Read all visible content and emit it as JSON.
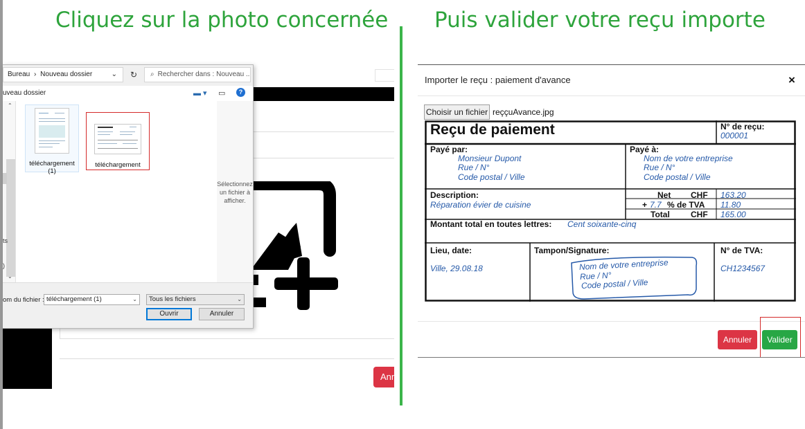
{
  "left": {
    "heading": "Cliquez sur la photo concernée",
    "dialog": {
      "breadcrumb": [
        "Bureau",
        "Nouveau dossier"
      ],
      "search_placeholder": "Rechercher dans : Nouveau ...",
      "new_folder_label": "uveau dossier",
      "files": [
        {
          "name_line1": "téléchargement",
          "name_line2": "(1)"
        },
        {
          "name_line1": "téléchargement",
          "name_line2": ""
        }
      ],
      "preview_text": [
        "Sélectionnez",
        "un fichier à",
        "afficher."
      ],
      "filename_label": "om du fichier :",
      "filename_value": "téléchargement (1)",
      "filetype_value": "Tous les fichiers",
      "open_label": "Ouvrir",
      "cancel_label": "Annuler",
      "nav_fragments": [
        "ts",
        ")"
      ]
    },
    "background_cancel_label": "Ann"
  },
  "right": {
    "heading": "Puis valider votre reçu importe",
    "modal": {
      "title": "Importer le reçu : paiement d'avance",
      "close_glyph": "×",
      "choose_file_label": "Choisir un fichier",
      "chosen_file": "reççuAvance.jpg",
      "cancel_label": "Annuler",
      "validate_label": "Valider"
    },
    "receipt": {
      "title": "Reçu de paiement",
      "number_label": "N° de reçu:",
      "number_value": "000001",
      "paid_by_label": "Payé par:",
      "paid_by_lines": [
        "Monsieur Dupont",
        "Rue / N°",
        "Code postal / Ville"
      ],
      "paid_to_label": "Payé à:",
      "paid_to_lines": [
        "Nom de votre entreprise",
        "Rue / N°",
        "Code postal / Ville"
      ],
      "description_label": "Description:",
      "description_value": "Réparation évier de cuisine",
      "net_label": "Net",
      "total_label": "Total",
      "currency": "CHF",
      "vat_prefix": "+",
      "vat_rate": "7.7",
      "vat_suffix": "% de TVA",
      "net_value": "163.20",
      "vat_value": "11.80",
      "total_value": "165.00",
      "amount_words_label": "Montant total en toutes lettres:",
      "amount_words_value": "Cent soixante-cinq",
      "place_date_label": "Lieu, date:",
      "place_date_value": "Ville, 29.08.18",
      "stamp_label": "Tampon/Signature:",
      "stamp_lines": [
        "Nom de votre entreprise",
        "Rue / N°",
        "Code postal / Ville"
      ],
      "vat_number_label": "N° de TVA:",
      "vat_number_value": "CH1234567"
    }
  },
  "colors": {
    "heading_green": "#2ea43c",
    "divider_green": "#3bb54a",
    "danger_red": "#dc3545",
    "success_green": "#28a745",
    "receipt_blue": "#2559a8",
    "highlight_red": "#d42a2a"
  },
  "icons": [
    "chevron-right-icon",
    "chevron-down-icon",
    "refresh-icon",
    "search-icon",
    "view-options-icon",
    "preview-pane-icon",
    "help-icon",
    "close-icon",
    "add-image-icon"
  ]
}
